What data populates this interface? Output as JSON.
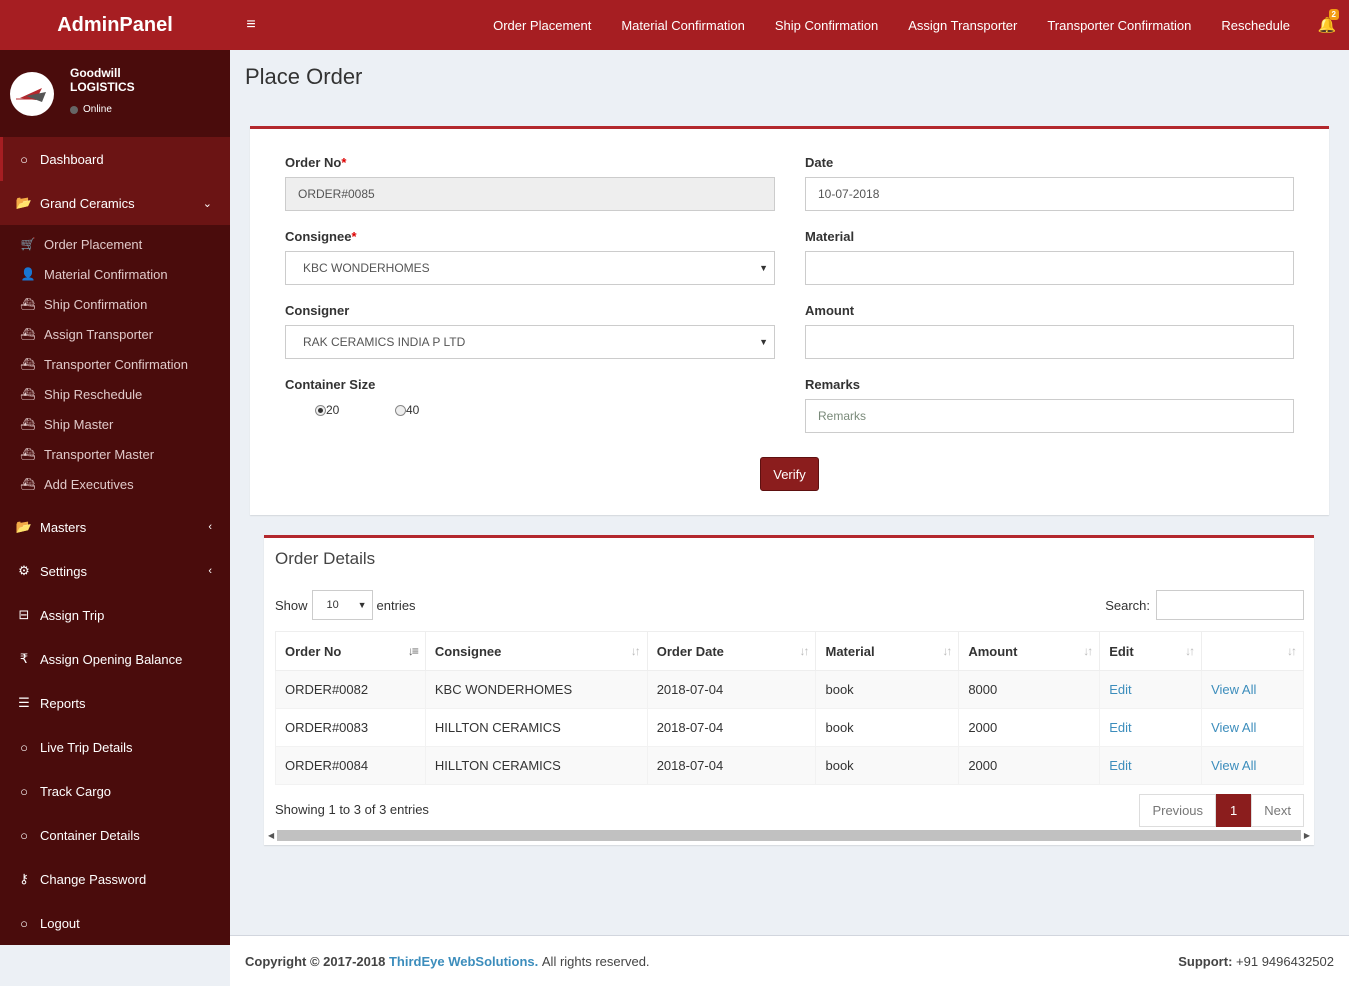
{
  "app": {
    "title": "AdminPanel",
    "company_line1": "Goodwill",
    "company_line2": "LOGISTICS",
    "status": "Online"
  },
  "sidebar": {
    "dashboard": "Dashboard",
    "group": "Grand Ceramics",
    "submenu": [
      "Order Placement",
      "Material Confirmation",
      "Ship Confirmation",
      "Assign Transporter",
      "Transporter Confirmation",
      "Ship Reschedule",
      "Ship Master",
      "Transporter Master",
      "Add Executives"
    ],
    "items": [
      "Masters",
      "Settings",
      "Assign Trip",
      "Assign Opening Balance",
      "Reports",
      "Live Trip Details",
      "Track Cargo",
      "Container Details",
      "Change Password",
      "Logout"
    ]
  },
  "topnav": {
    "links": [
      "Order Placement",
      "Material Confirmation",
      "Ship Confirmation",
      "Assign Transporter",
      "Transporter Confirmation",
      "Reschedule"
    ],
    "notif_count": "2"
  },
  "page": {
    "title": "Place Order"
  },
  "form": {
    "order_no_label": "Order No",
    "order_no_value": "ORDER#0085",
    "date_label": "Date",
    "date_value": "10-07-2018",
    "consignee_label": "Consignee",
    "consignee_value": "KBC WONDERHOMES",
    "material_label": "Material",
    "material_value": "",
    "consigner_label": "Consigner",
    "consigner_value": "RAK CERAMICS INDIA P LTD",
    "amount_label": "Amount",
    "amount_value": "",
    "container_label": "Container Size",
    "size_20": "20",
    "size_40": "40",
    "remarks_label": "Remarks",
    "remarks_placeholder": "Remarks",
    "verify": "Verify"
  },
  "table": {
    "title": "Order Details",
    "show": "Show",
    "entries": "entries",
    "length": "10",
    "search": "Search:",
    "columns": [
      "Order No",
      "Consignee",
      "Order Date",
      "Material",
      "Amount",
      "Edit",
      ""
    ],
    "rows": [
      [
        "ORDER#0082",
        "KBC WONDERHOMES",
        "2018-07-04",
        "book",
        "8000",
        "Edit",
        "View All"
      ],
      [
        "ORDER#0083",
        "HILLTON CERAMICS",
        "2018-07-04",
        "book",
        "2000",
        "Edit",
        "View All"
      ],
      [
        "ORDER#0084",
        "HILLTON CERAMICS",
        "2018-07-04",
        "book",
        "2000",
        "Edit",
        "View All"
      ]
    ],
    "info": "Showing 1 to 3 of 3 entries",
    "prev": "Previous",
    "page": "1",
    "next": "Next"
  },
  "footer": {
    "copyright": "Copyright © 2017-2018",
    "brand": "ThirdEye WebSolutions.",
    "rights": "All rights reserved.",
    "support_label": "Support:",
    "support_phone": "+91 9496432502"
  }
}
